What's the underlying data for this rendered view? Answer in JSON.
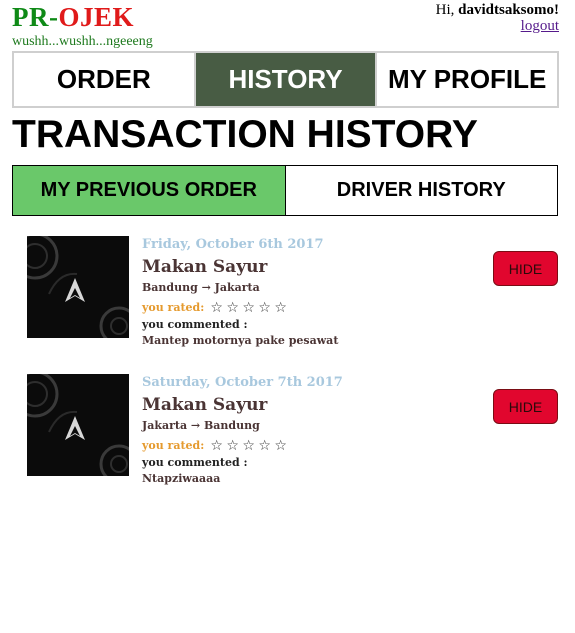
{
  "header": {
    "logo_part1": "PR",
    "logo_sep": "-",
    "logo_part2": "OJEK",
    "tagline": "wushh...wushh...ngeeeng",
    "greeting_prefix": "Hi, ",
    "username": "davidtsaksomo!",
    "logout_label": "logout"
  },
  "nav": {
    "tabs": [
      {
        "label": "ORDER"
      },
      {
        "label": "HISTORY",
        "active": true
      },
      {
        "label": "MY PROFILE"
      }
    ]
  },
  "page_title": "TRANSACTION HISTORY",
  "subtabs": [
    {
      "label": "MY PREVIOUS ORDER",
      "active": true
    },
    {
      "label": "DRIVER HISTORY"
    }
  ],
  "orders": [
    {
      "date": "Friday, October 6th 2017",
      "name": "Makan Sayur",
      "route": "Bandung → Jakarta",
      "rated_label": "you rated:",
      "rating": 0,
      "max_rating": 5,
      "comment_label": "you commented :",
      "comment": "Mantep motornya pake pesawat",
      "hide_label": "HIDE"
    },
    {
      "date": "Saturday, October 7th 2017",
      "name": "Makan Sayur",
      "route": "Jakarta → Bandung",
      "rated_label": "you rated:",
      "rating": 0,
      "max_rating": 5,
      "comment_label": "you commented :",
      "comment": "Ntapziwaaaa",
      "hide_label": "HIDE"
    }
  ],
  "colors": {
    "logo_green": "#0f8a17",
    "logo_red": "#e01a1a",
    "nav_active_bg": "#485c44",
    "subtab_active_bg": "#6ac86a",
    "hide_button_bg": "#e1062e",
    "date_color": "#a8c8de",
    "rated_label_color": "#e59a2e"
  },
  "icons": {
    "star": "empty-star-icon",
    "arrow": "right-arrow"
  }
}
